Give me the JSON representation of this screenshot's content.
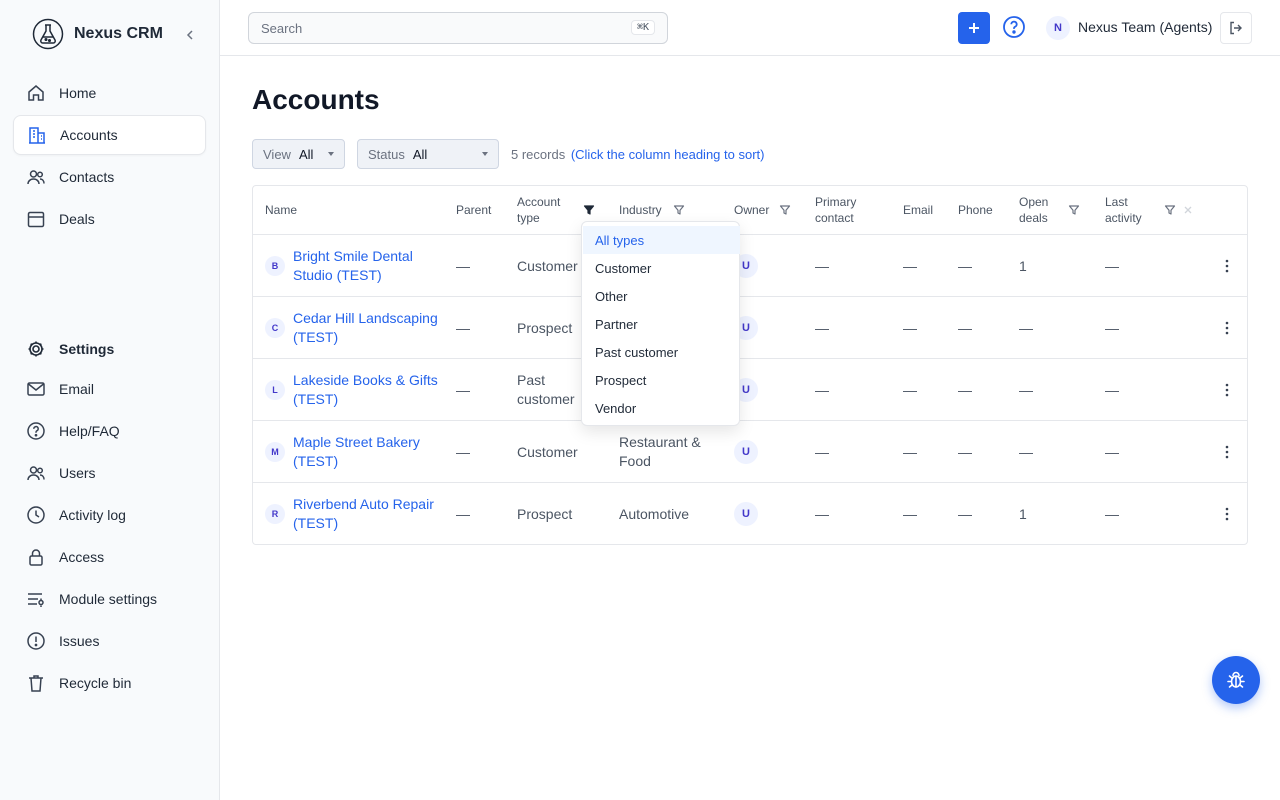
{
  "app": {
    "name": "Nexus CRM"
  },
  "sidebar": {
    "primary": [
      {
        "label": "Home",
        "icon": "home-icon",
        "active": false
      },
      {
        "label": "Accounts",
        "icon": "building-icon",
        "active": true
      },
      {
        "label": "Contacts",
        "icon": "users-icon",
        "active": false
      },
      {
        "label": "Deals",
        "icon": "calendar-icon",
        "active": false
      }
    ],
    "settings": {
      "label": "Settings",
      "icon": "gear-icon"
    },
    "secondary": [
      {
        "label": "Email",
        "icon": "mail-icon"
      },
      {
        "label": "Help/FAQ",
        "icon": "help-icon"
      },
      {
        "label": "Users",
        "icon": "users-icon"
      },
      {
        "label": "Activity log",
        "icon": "clock-icon"
      },
      {
        "label": "Access",
        "icon": "lock-icon"
      },
      {
        "label": "Module settings",
        "icon": "sliders-icon"
      },
      {
        "label": "Issues",
        "icon": "alert-icon"
      },
      {
        "label": "Recycle bin",
        "icon": "trash-icon"
      }
    ]
  },
  "topbar": {
    "search_placeholder": "Search",
    "shortcut": "⌘K",
    "add_label": "+",
    "user_initial": "N",
    "user_name": "Nexus Team (Agents)"
  },
  "page": {
    "title": "Accounts",
    "filters": {
      "view": {
        "label": "View",
        "value": "All"
      },
      "status": {
        "label": "Status",
        "value": "All"
      }
    },
    "records_count": "5 records",
    "sort_hint": "(Click the column heading to sort)"
  },
  "table": {
    "columns": {
      "name": "Name",
      "parent": "Parent",
      "account_type": "Account type",
      "industry": "Industry",
      "owner": "Owner",
      "primary_contact": "Primary contact",
      "email": "Email",
      "phone": "Phone",
      "open_deals": "Open deals",
      "last_activity": "Last activity"
    },
    "rows": [
      {
        "initial": "B",
        "name": "Bright Smile Dental Studio (TEST)",
        "parent": "—",
        "type": "Customer",
        "industry": "",
        "owner": "U",
        "contact": "—",
        "email": "—",
        "phone": "—",
        "deals": "1",
        "last": "—"
      },
      {
        "initial": "C",
        "name": "Cedar Hill Landscaping (TEST)",
        "parent": "—",
        "type": "Prospect",
        "industry": "",
        "owner": "U",
        "contact": "—",
        "email": "—",
        "phone": "—",
        "deals": "—",
        "last": "—"
      },
      {
        "initial": "L",
        "name": "Lakeside Books & Gifts (TEST)",
        "parent": "—",
        "type": "Past customer",
        "industry": "",
        "owner": "U",
        "contact": "—",
        "email": "—",
        "phone": "—",
        "deals": "—",
        "last": "—"
      },
      {
        "initial": "M",
        "name": "Maple Street Bakery (TEST)",
        "parent": "—",
        "type": "Customer",
        "industry": "Restaurant & Food",
        "owner": "U",
        "contact": "—",
        "email": "—",
        "phone": "—",
        "deals": "—",
        "last": "—"
      },
      {
        "initial": "R",
        "name": "Riverbend Auto Repair (TEST)",
        "parent": "—",
        "type": "Prospect",
        "industry": "Automotive",
        "owner": "U",
        "contact": "—",
        "email": "—",
        "phone": "—",
        "deals": "1",
        "last": "—"
      }
    ]
  },
  "dropdown": {
    "items": [
      "All types",
      "Customer",
      "Other",
      "Partner",
      "Past customer",
      "Prospect",
      "Vendor"
    ],
    "selected": "All types"
  },
  "colors": {
    "accent": "#2563eb",
    "sidebar_bg": "#f8fafc"
  }
}
